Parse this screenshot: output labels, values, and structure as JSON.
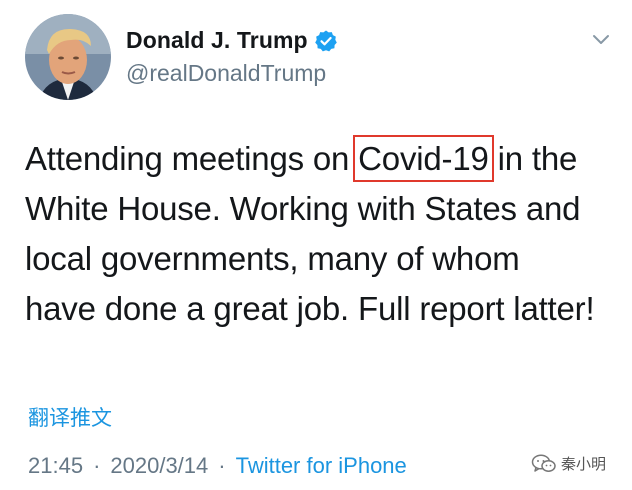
{
  "tweet": {
    "display_name": "Donald J. Trump",
    "handle": "@realDonaldTrump",
    "verified": true,
    "text_lines": [
      {
        "before": "Attending meetings on ",
        "highlight": "Covid-19",
        "after": " in the"
      },
      {
        "text": "White House. Working with States and"
      },
      {
        "text": "local governments, many of whom"
      },
      {
        "text": "have done a great job. Full report latter!"
      }
    ],
    "translate_label": "翻译推文",
    "time": "21:45",
    "separator1": "·",
    "date": "2020/3/14",
    "separator2": "·",
    "source": "Twitter for iPhone"
  },
  "watermark": {
    "text": "秦小明",
    "icon": "wechat-icon"
  },
  "colors": {
    "link_blue": "#1b95e0",
    "secondary_gray": "#657786",
    "highlight_red": "#e0392c",
    "verified_blue": "#1da1f2"
  }
}
